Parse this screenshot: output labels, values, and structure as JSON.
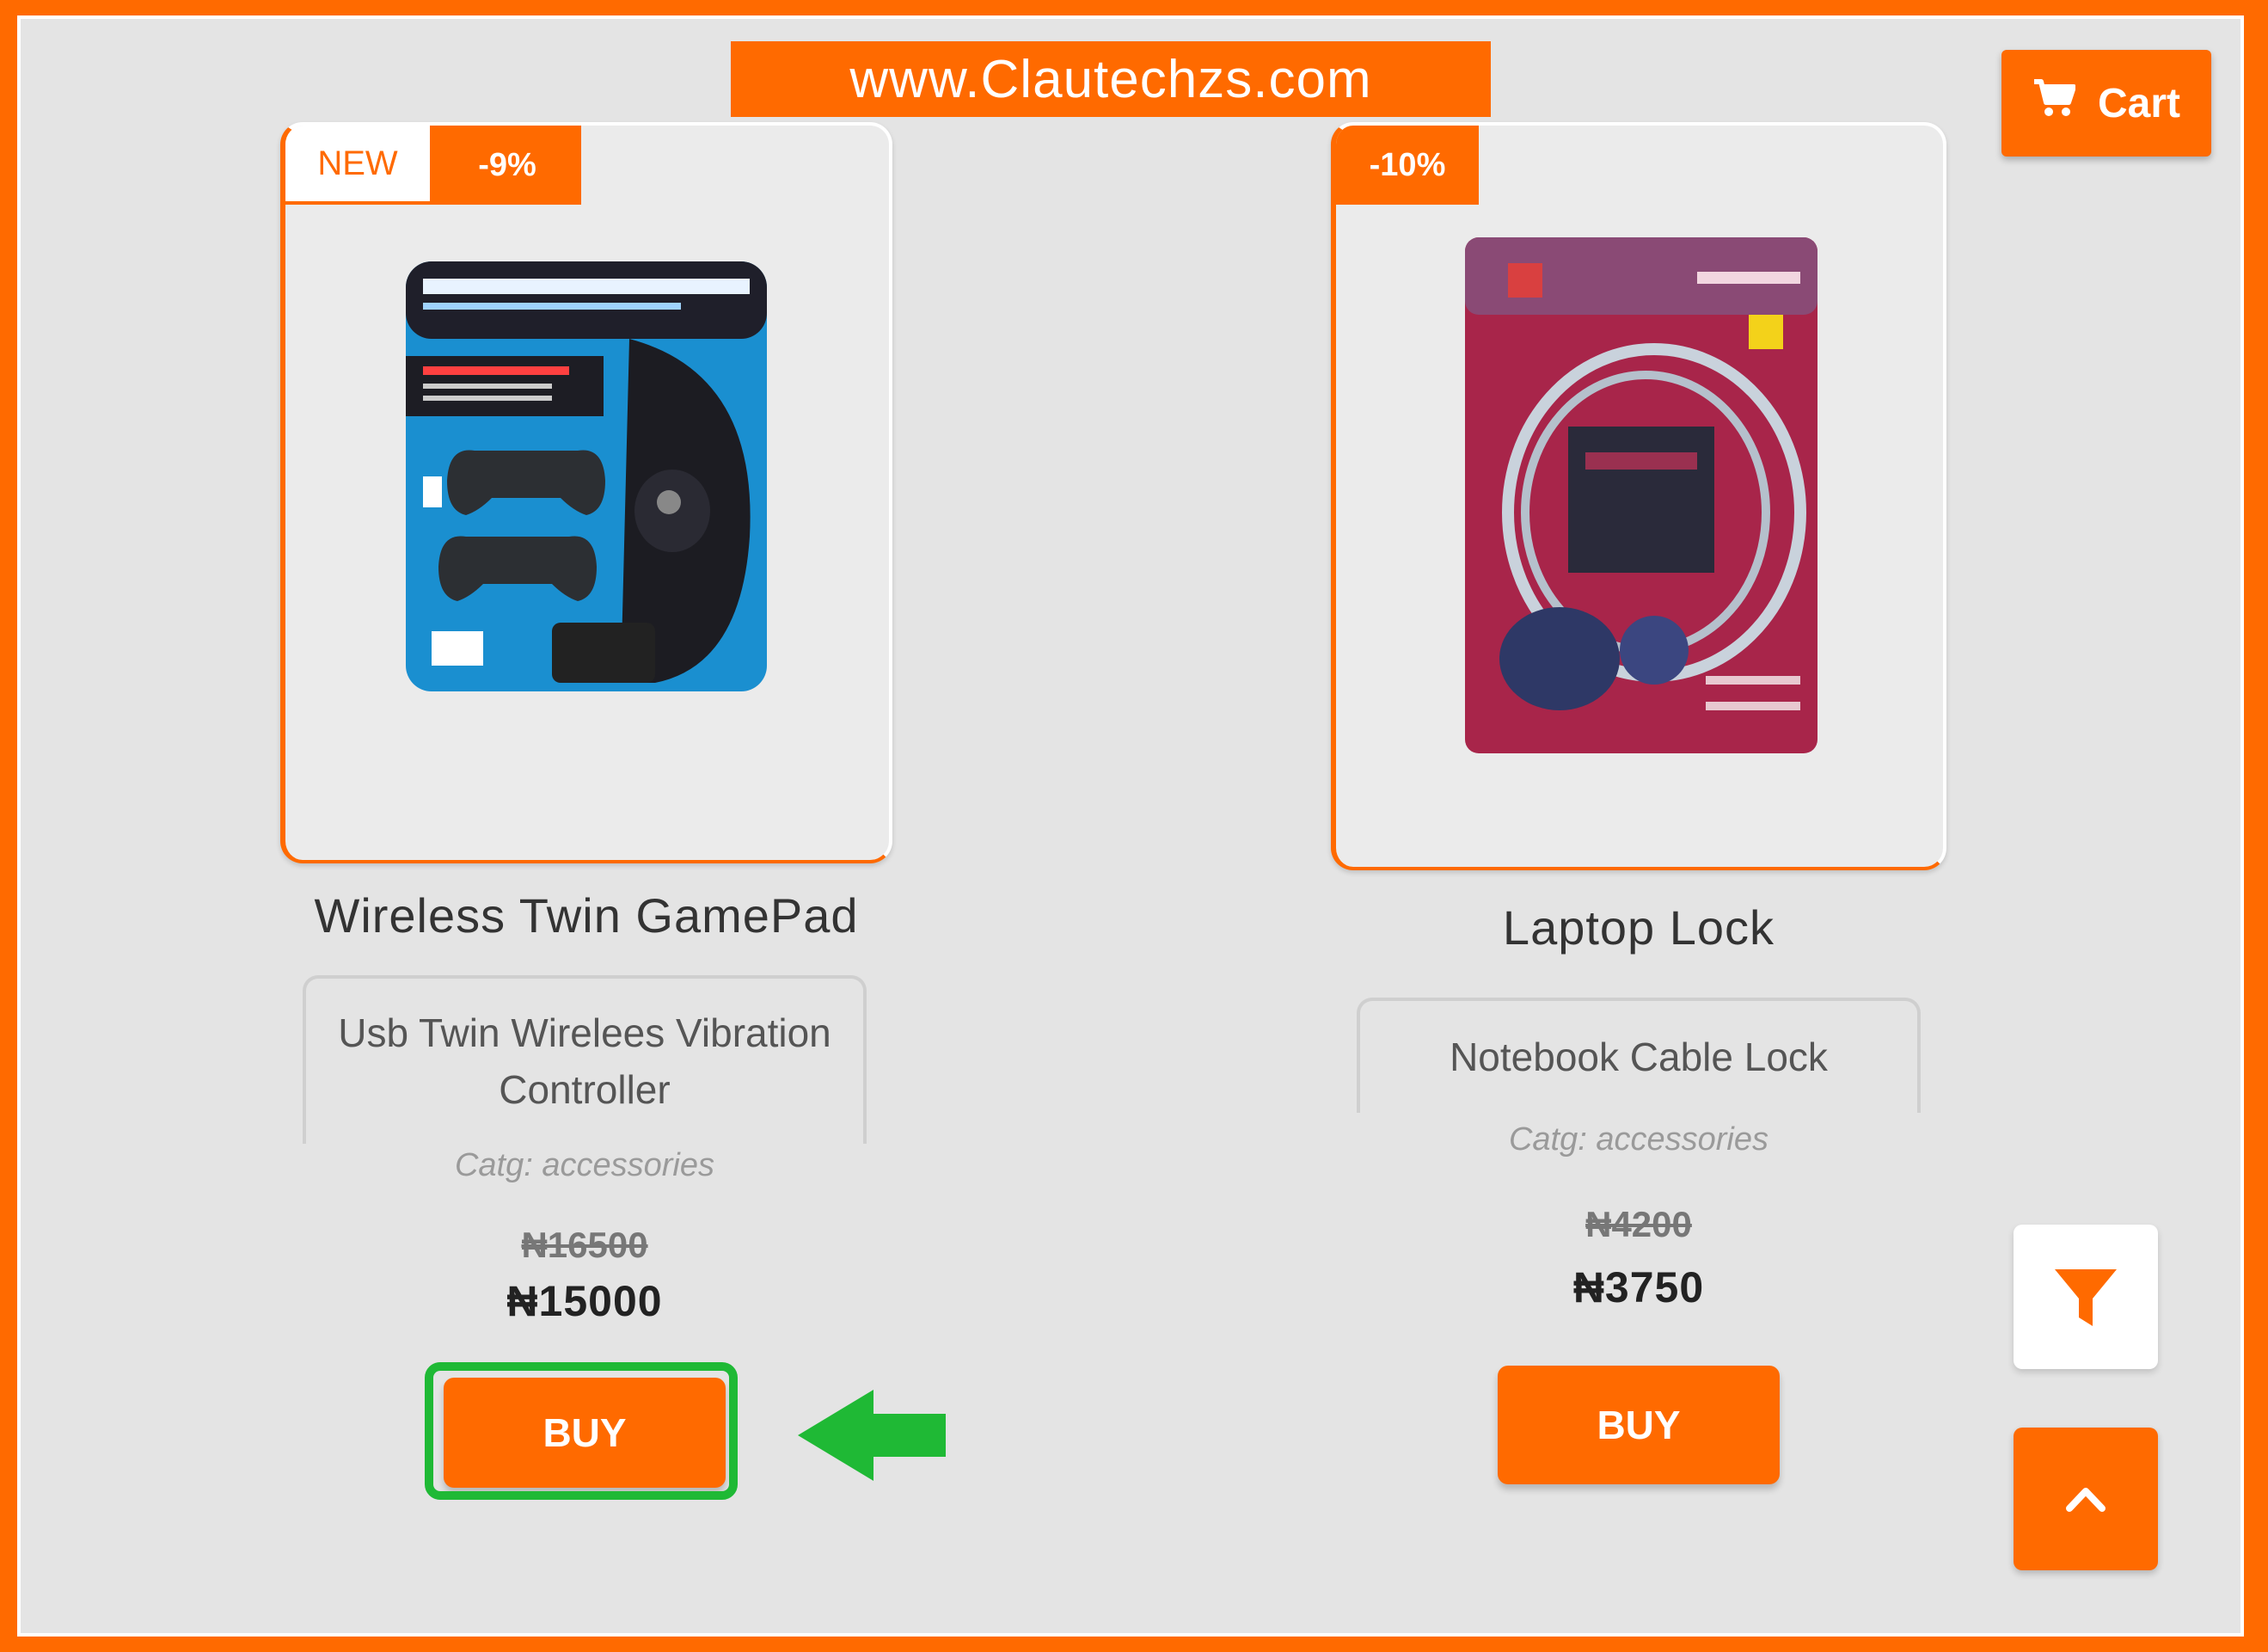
{
  "site": {
    "banner_text": "www.Clautechzs.com"
  },
  "cart": {
    "label": "Cart",
    "icon": "cart-icon"
  },
  "products": [
    {
      "badge_new": "NEW",
      "badge_discount": "-9%",
      "title": "Wireless Twin GamePad",
      "description": "Usb Twin Wirelees Vibration Controller",
      "category": "Catg: accessories",
      "old_price": "₦16500",
      "price": "₦15000",
      "buy_label": "BUY"
    },
    {
      "badge_discount": "-10%",
      "title": "Laptop Lock",
      "description": "Notebook Cable Lock",
      "category": "Catg: accessories",
      "old_price": "₦4200",
      "price": "₦3750",
      "buy_label": "BUY"
    }
  ],
  "controls": {
    "filter_icon": "filter-icon",
    "scroll_top_icon": "chevron-up-icon"
  },
  "colors": {
    "accent": "#ff6a00",
    "highlight": "#1fb935",
    "background": "#e4e4e4"
  }
}
